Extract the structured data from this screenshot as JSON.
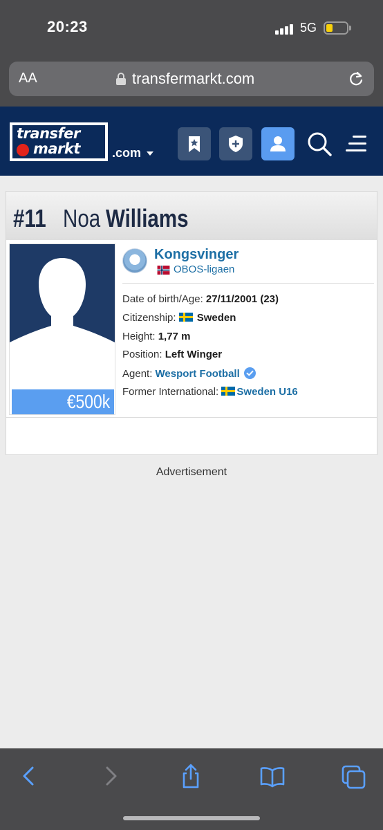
{
  "status_bar": {
    "time": "20:23",
    "network": "5G"
  },
  "browser": {
    "text_size_label": "AA",
    "url": "transfermarkt.com"
  },
  "site_header": {
    "logo_line1": "transfer",
    "logo_line2": "markt",
    "domain": ".com",
    "buttons": [
      "bookmark-button",
      "club-shield-button",
      "profile-button",
      "search-button",
      "menu-button"
    ]
  },
  "player": {
    "number": "#11",
    "first_name": "Noa",
    "last_name": "Williams",
    "market_value": "€500k",
    "club": "Kongsvinger",
    "league": "OBOS-ligaen",
    "details": {
      "dob_label": "Date of birth/Age:",
      "dob_value": "27/11/2001 (23)",
      "citizenship_label": "Citizenship:",
      "citizenship_value": "Sweden",
      "height_label": "Height:",
      "height_value": "1,77 m",
      "position_label": "Position:",
      "position_value": "Left Winger",
      "agent_label": "Agent:",
      "agent_value": "Wesport Football",
      "former_intl_label": "Former International:",
      "former_intl_value": "Sweden U16"
    }
  },
  "advertisement_label": "Advertisement",
  "colors": {
    "header_navy": "#0b2a5a",
    "accent_blue": "#5a9ef0",
    "link_blue": "#1d6fa5",
    "browser_chrome": "#4a4a4c"
  }
}
